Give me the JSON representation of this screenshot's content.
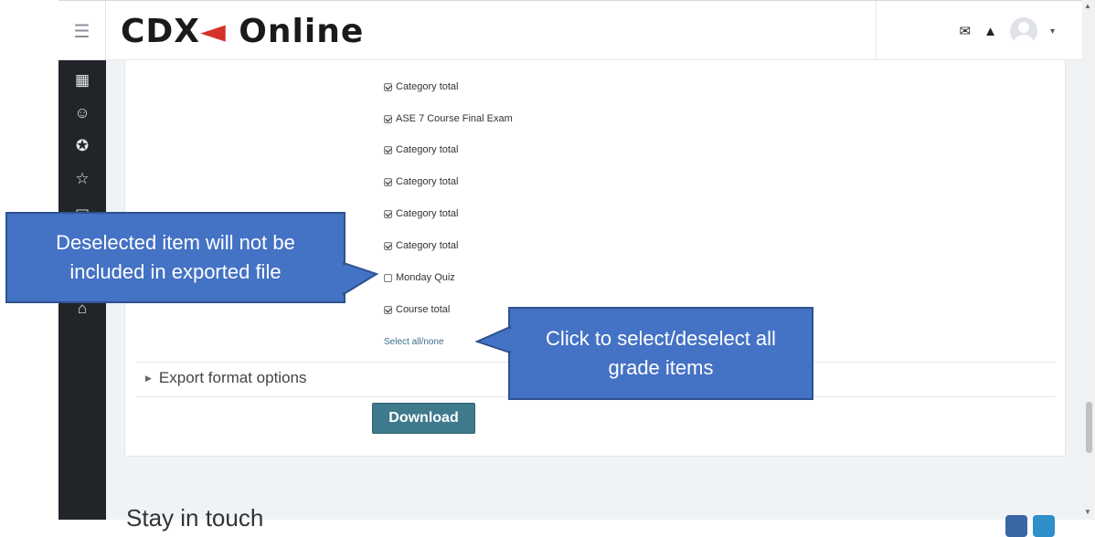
{
  "header": {
    "brand_prefix": "CDX",
    "brand_x": "",
    "brand_suffix": " Online",
    "menu_icon": "☰",
    "mail_icon": "✉",
    "bell_icon": "🔔",
    "caret": "▾"
  },
  "sidebar": {
    "icons": [
      {
        "name": "dashboard-grid-icon",
        "glyph": "▦"
      },
      {
        "name": "participants-icon",
        "glyph": "☺"
      },
      {
        "name": "badges-icon",
        "glyph": "✪"
      },
      {
        "name": "competencies-icon",
        "glyph": "☆"
      },
      {
        "name": "map-icon",
        "glyph": "▭"
      },
      {
        "name": "course-icon",
        "glyph": "⌂"
      }
    ]
  },
  "grade_items": [
    {
      "label": "Category total",
      "checked": true
    },
    {
      "label": "ASE 7 Course Final Exam",
      "checked": true
    },
    {
      "label": "Category total",
      "checked": true
    },
    {
      "label": "Category total",
      "checked": true
    },
    {
      "label": "Category total",
      "checked": true
    },
    {
      "label": "Category total",
      "checked": true
    },
    {
      "label": "Monday Quiz",
      "checked": false
    },
    {
      "label": "Course total",
      "checked": true
    }
  ],
  "select_all_none": "Select all/none",
  "export_format_options": "Export format options",
  "download_label": "Download",
  "footer": {
    "stay_in_touch": "Stay in touch"
  },
  "callouts": {
    "deselected": "Deselected item will not be included in exported file",
    "select_all": "Click to select/deselect all grade items"
  },
  "colors": {
    "callout": "#4472c4",
    "download": "#3e7a8c",
    "sidebar": "#212529"
  }
}
